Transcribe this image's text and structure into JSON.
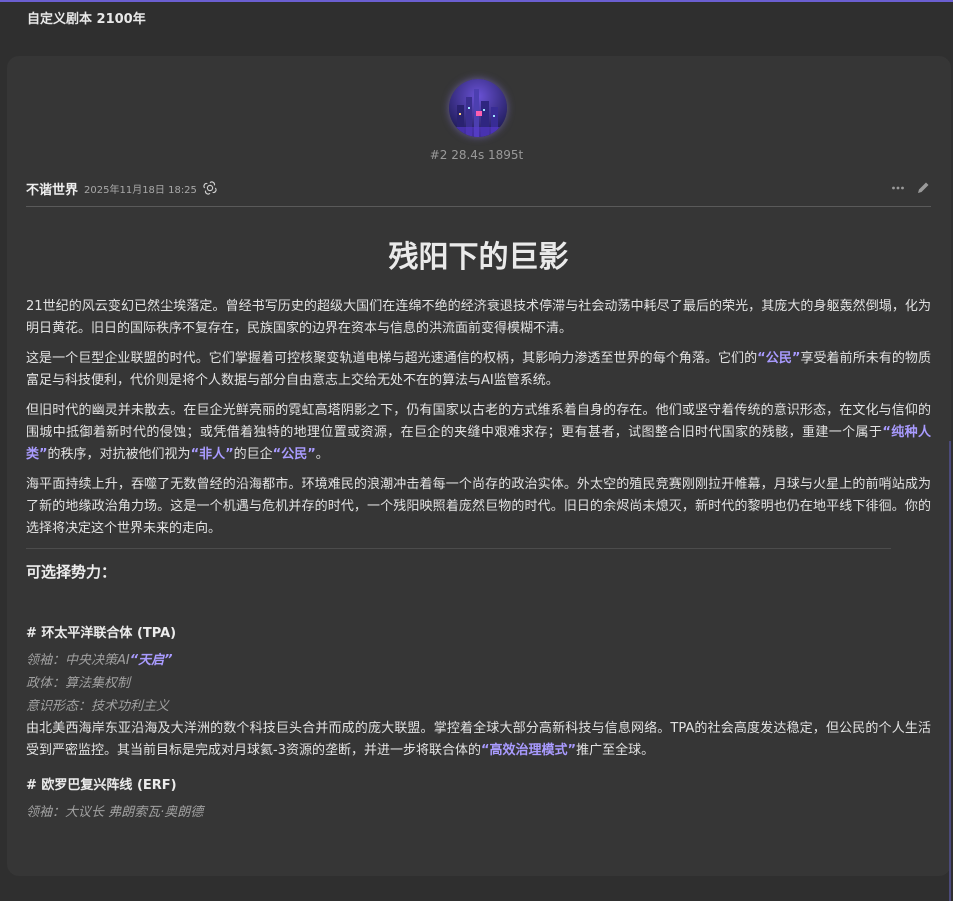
{
  "window": {
    "title": "自定义剧本 2100年"
  },
  "message": {
    "stats": "#2 28.4s 1895t",
    "author": "不谐世界",
    "date": "2025年11月18日 18:25",
    "model_icon": "openai-icon",
    "actions": [
      "more-icon",
      "edit-icon"
    ]
  },
  "article": {
    "title": "残阳下的巨影",
    "p1": "21世纪的风云变幻已然尘埃落定。曾经书写历史的超级大国们在连绵不绝的经济衰退技术停滞与社会动荡中耗尽了最后的荣光，其庞大的身躯轰然倒塌，化为明日黄花。旧日的国际秩序不复存在，民族国家的边界在资本与信息的洪流面前变得模糊不清。",
    "p2_a": "这是一个巨型企业联盟的时代。它们掌握着可控核聚变轨道电梯与超光速通信的权柄，其影响力渗透至世界的每个角落。它们的",
    "p2_hl": "“公民”",
    "p2_b": "享受着前所未有的物质富足与科技便利，代价则是将个人数据与部分自由意志上交给无处不在的算法与AI监管系统。",
    "p3_a": "但旧时代的幽灵并未散去。在巨企光鲜亮丽的霓虹高塔阴影之下，仍有国家以古老的方式维系着自身的存在。他们或坚守着传统的意识形态，在文化与信仰的围城中抵御着新时代的侵蚀；或凭借着独特的地理位置或资源，在巨企的夹缝中艰难求存；更有甚者，试图整合旧时代国家的残骸，重建一个属于",
    "p3_hl1": "“纯种人类”",
    "p3_b": "的秩序，对抗被他们视为",
    "p3_hl2": "“非人”",
    "p3_c": "的巨企",
    "p3_hl3": "“公民”",
    "p3_d": "。",
    "p4": "海平面持续上升，吞噬了无数曾经的沿海都市。环境难民的浪潮冲击着每一个尚存的政治实体。外太空的殖民竞赛刚刚拉开帷幕，月球与火星上的前哨站成为了新的地缘政治角力场。这是一个机遇与危机并存的时代，一个残阳映照着庞然巨物的时代。旧日的余烬尚未熄灭，新时代的黎明也仍在地平线下徘徊。你的选择将决定这个世界未来的走向。",
    "section": "可选择势力：",
    "f1": {
      "heading": "# 环太平洋联合体 (TPA)",
      "leader_label": "领袖：中央决策AI",
      "leader_hl": "“天启”",
      "polity": "政体：算法集权制",
      "ideology": "意识形态：技术功利主义",
      "desc_a": "由北美西海岸东亚沿海及大洋洲的数个科技巨头合并而成的庞大联盟。掌控着全球大部分高新科技与信息网络。TPA的社会高度发达稳定，但公民的个人生活受到严密监控。其当前目标是完成对月球氦-3资源的垄断，并进一步将联合体的",
      "desc_hl": "“高效治理模式”",
      "desc_b": "推广至全球。"
    },
    "f2": {
      "heading": "# 欧罗巴复兴阵线 (ERF)",
      "leader": "领袖：大议长 弗朗索瓦·奥朗德"
    }
  }
}
